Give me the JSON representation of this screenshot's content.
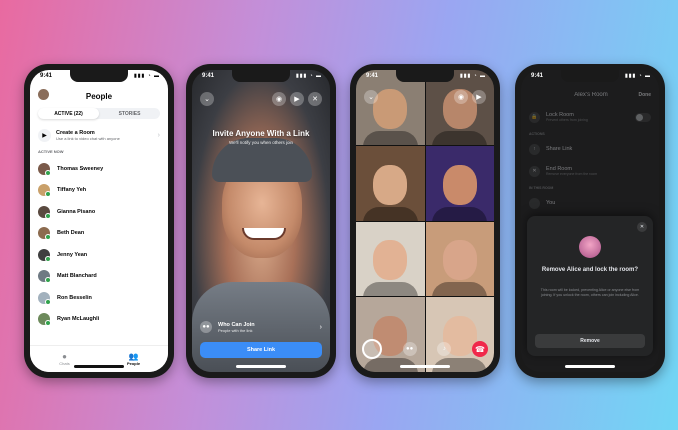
{
  "status_time": "9:41",
  "status_icons": "▮▮▮ ◔ ▬",
  "phone1": {
    "title": "People",
    "tabs": [
      "ACTIVE (22)",
      "STORIES"
    ],
    "create_room": {
      "title": "Create a Room",
      "subtitle": "Use a link to video chat with anyone"
    },
    "section": "ACTIVE NOW",
    "people": [
      {
        "name": "Thomas Sweeney",
        "color": "#7a5a4a"
      },
      {
        "name": "Tiffany Yeh",
        "color": "#c9a06a"
      },
      {
        "name": "Gianna Pisano",
        "color": "#5a4a40"
      },
      {
        "name": "Beth Dean",
        "color": "#8c6b4f"
      },
      {
        "name": "Jenny Yean",
        "color": "#3f3f3f"
      },
      {
        "name": "Matt Blanchard",
        "color": "#6f7a83"
      },
      {
        "name": "Ron Besselin",
        "color": "#a2b1bd"
      },
      {
        "name": "Ryan McLaughli",
        "color": "#6d8a5c"
      }
    ],
    "bottom_tabs": [
      "Chats",
      "People"
    ]
  },
  "phone2": {
    "headline": "Invite Anyone With a Link",
    "subheadline": "We'll notify you when others join",
    "who_title": "Who Can Join",
    "who_subtitle": "People with the link",
    "share_button": "Share Link"
  },
  "phone3": {
    "tile_colors": [
      "#8b7f73",
      "#5d5047",
      "#6b4f3a",
      "#3a2a6a",
      "#d9d2c7",
      "#c89c7a",
      "#b6a79a",
      "#d7c6b5"
    ],
    "face_colors": [
      "#c99a76",
      "#b7866a",
      "#d7a987",
      "#c98a6a",
      "#e2b294",
      "#d8a58a",
      "#c08c72",
      "#e3bba0"
    ]
  },
  "phone4": {
    "nav_title": "Alex's Room",
    "nav_done": "Done",
    "lock_room": "Lock Room",
    "lock_sub": "Prevent others from joining",
    "actions_label": "ACTIONS",
    "share_link": "Share Link",
    "end_room": "End Room",
    "end_sub": "Remove everyone from the room",
    "in_room_label": "IN THIS ROOM",
    "you": "You",
    "sheet_title": "Remove Alice and lock the room?",
    "sheet_desc": "This room will be locked, preventing Alice or anyone else from joining. If you unlock the room, others can join including Alice.",
    "sheet_button": "Remove"
  }
}
